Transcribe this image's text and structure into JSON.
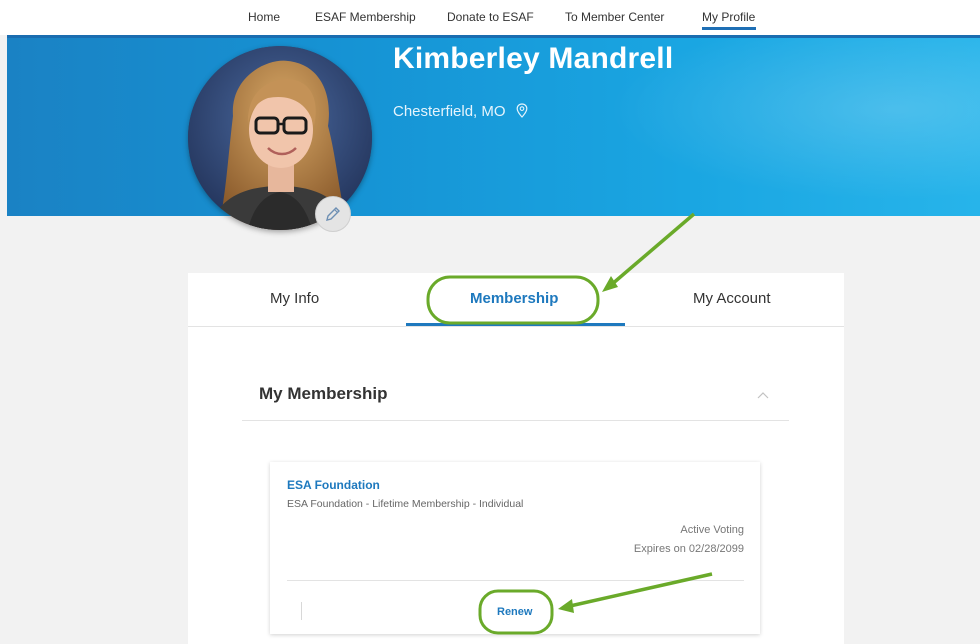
{
  "nav": {
    "items": [
      "Home",
      "ESAF Membership",
      "Donate to ESAF",
      "To Member Center",
      "My Profile"
    ],
    "active": "My Profile"
  },
  "profile": {
    "name": "Kimberley Mandrell",
    "location": "Chesterfield, MO"
  },
  "tabs": [
    "My Info",
    "Membership",
    "My Account"
  ],
  "active_tab": "Membership",
  "section": {
    "title": "My Membership",
    "expanded": true
  },
  "membership": {
    "organization": "ESA Foundation",
    "plan": "ESA Foundation - Lifetime Membership - Individual",
    "status": "Active Voting",
    "expires": "Expires on 02/28/2099",
    "renew_label": "Renew"
  },
  "colors": {
    "accent": "#1e79be",
    "banner": "#1693d4",
    "annotation": "#6aaa2a"
  },
  "icons": {
    "location": "map-pin-icon",
    "edit": "pencil-icon",
    "collapse": "chevron-up-icon"
  }
}
